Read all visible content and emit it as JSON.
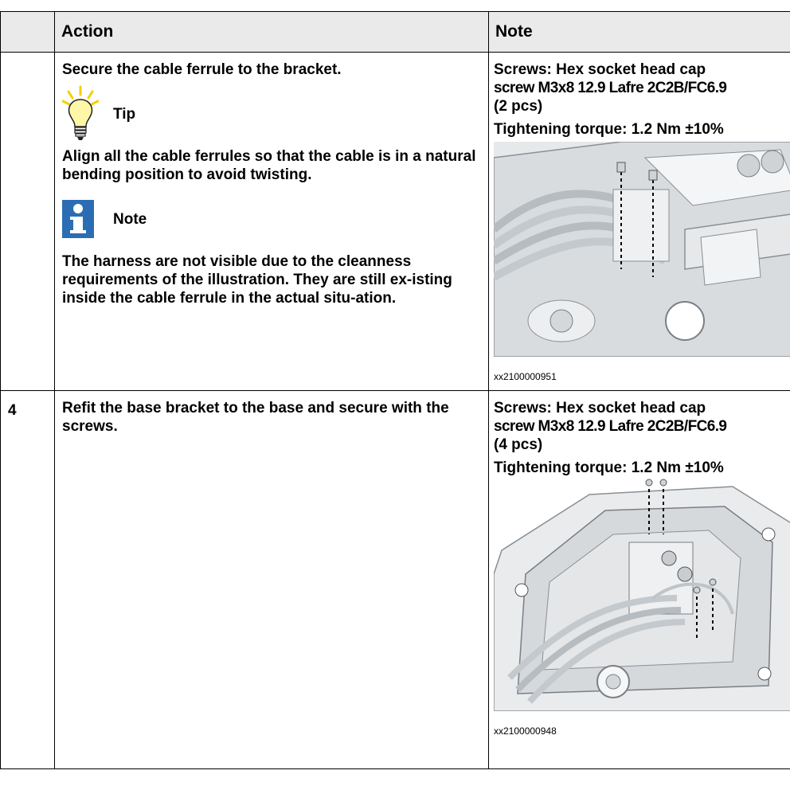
{
  "table": {
    "header": {
      "step": "",
      "action": "Action",
      "note": "Note"
    },
    "rows": [
      {
        "step": "",
        "action_text": "Secure the cable ferrule to the bracket.",
        "tip_label": "Tip",
        "tip_text": "Align all the cable ferrules so that the cable is in a natural bending position to avoid twisting.",
        "note_label": "Note",
        "note_text": "The harness are not visible due to the cleanness requirements of the illustration. They are still ex-isting inside the cable ferrule in the actual situ-ation.",
        "screws_line1": "Screws: Hex socket head cap",
        "screws_line2": "screw M3x8 12.9 Lafre 2C2B/FC6.9",
        "screws_line3": "(2 pcs)",
        "torque": "Tightening torque: 1.2 Nm ±10%",
        "figure_id": "xx2100000951"
      },
      {
        "step": "4",
        "action_text": "Refit the base bracket to the base and secure with the screws.",
        "screws_line1": "Screws: Hex socket head cap",
        "screws_line2": "screw M3x8 12.9 Lafre 2C2B/FC6.9",
        "screws_line3": "(4 pcs)",
        "torque": "Tightening torque: 1.2 Nm ±10%",
        "figure_id": "xx2100000948"
      }
    ]
  },
  "icons": {
    "tip": "lightbulb-icon",
    "note": "info-icon"
  },
  "colors": {
    "header_bg": "#eaeaea",
    "tip_yellow": "#f4d000",
    "info_blue": "#2b6db3"
  }
}
